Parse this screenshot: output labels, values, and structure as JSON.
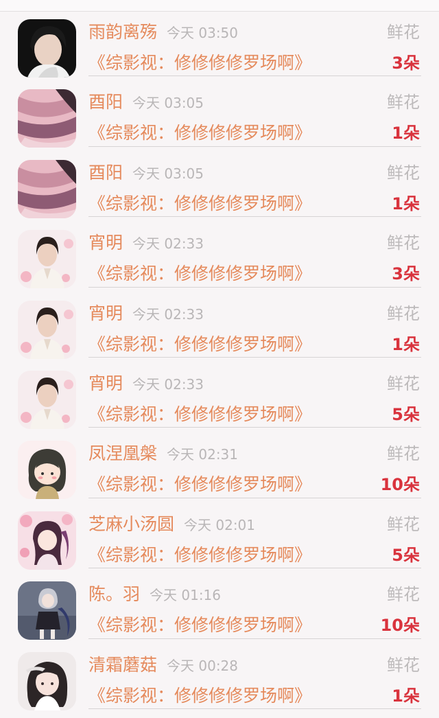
{
  "rows": [
    {
      "name": "雨韵离殇",
      "time": "今天 03:50",
      "gift_type": "鲜花",
      "book": "《综影视：修修修修罗场啊》",
      "count": "3朵",
      "avatar_icon": "avatar-dark-hair-man"
    },
    {
      "name": "酉阳",
      "time": "今天 03:05",
      "gift_type": "鲜花",
      "book": "《综影视：修修修修罗场啊》",
      "count": "1朵",
      "avatar_icon": "avatar-pink-fabric"
    },
    {
      "name": "酉阳",
      "time": "今天 03:05",
      "gift_type": "鲜花",
      "book": "《综影视：修修修修罗场啊》",
      "count": "1朵",
      "avatar_icon": "avatar-pink-fabric"
    },
    {
      "name": "宵明",
      "time": "今天 02:33",
      "gift_type": "鲜花",
      "book": "《综影视：修修修修罗场啊》",
      "count": "3朵",
      "avatar_icon": "avatar-costume-man"
    },
    {
      "name": "宵明",
      "time": "今天 02:33",
      "gift_type": "鲜花",
      "book": "《综影视：修修修修罗场啊》",
      "count": "1朵",
      "avatar_icon": "avatar-costume-man"
    },
    {
      "name": "宵明",
      "time": "今天 02:33",
      "gift_type": "鲜花",
      "book": "《综影视：修修修修罗场啊》",
      "count": "5朵",
      "avatar_icon": "avatar-costume-man"
    },
    {
      "name": "凤涅凰槃",
      "time": "今天 02:31",
      "gift_type": "鲜花",
      "book": "《综影视：修修修修罗场啊》",
      "count": "10朵",
      "avatar_icon": "avatar-chibi-girl"
    },
    {
      "name": "芝麻小汤圆",
      "time": "今天 02:01",
      "gift_type": "鲜花",
      "book": "《综影视：修修修修罗场啊》",
      "count": "5朵",
      "avatar_icon": "avatar-anime-blossom"
    },
    {
      "name": "陈。羽",
      "time": "今天 01:16",
      "gift_type": "鲜花",
      "book": "《综影视：修修修修罗场啊》",
      "count": "10朵",
      "avatar_icon": "avatar-anime-figure"
    },
    {
      "name": "清霜蘑菇",
      "time": "今天 00:28",
      "gift_type": "鲜花",
      "book": "《综影视：修修修修罗场啊》",
      "count": "1朵",
      "avatar_icon": "avatar-anime-girl"
    }
  ],
  "colors": {
    "name": "#e58a5c",
    "count": "#d9333d",
    "muted": "#bdbabb",
    "background": "#f8f5f6"
  }
}
